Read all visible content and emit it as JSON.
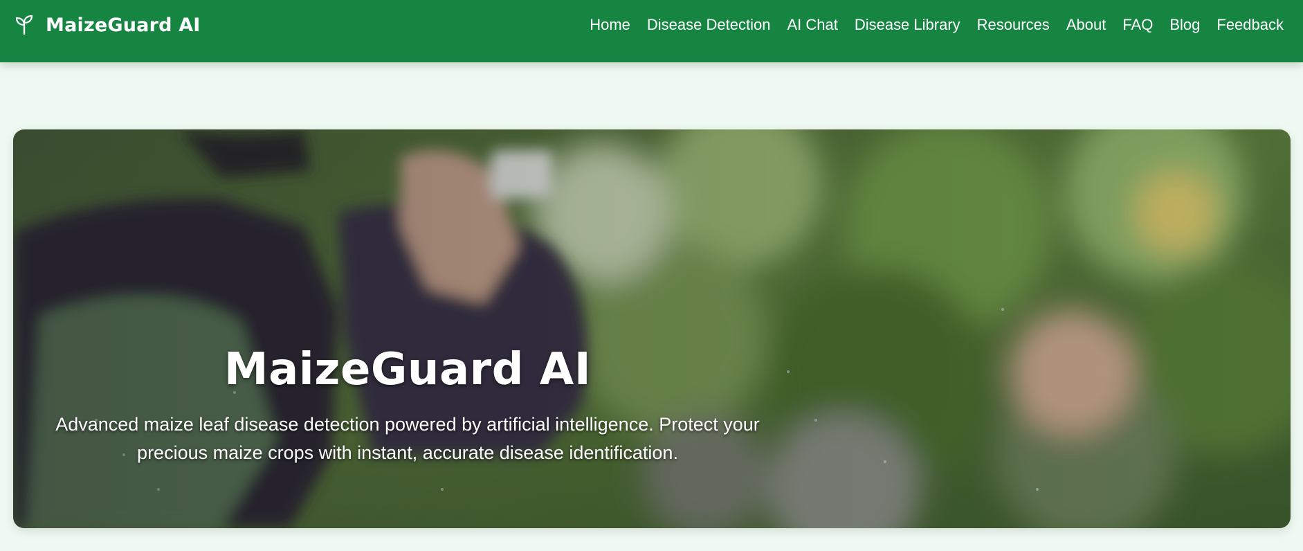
{
  "brand": {
    "name": "MaizeGuard AI",
    "icon": "seedling-icon"
  },
  "nav": {
    "items": [
      {
        "label": "Home"
      },
      {
        "label": "Disease Detection"
      },
      {
        "label": "AI Chat"
      },
      {
        "label": "Disease Library"
      },
      {
        "label": "Resources"
      },
      {
        "label": "About"
      },
      {
        "label": "FAQ"
      },
      {
        "label": "Blog"
      },
      {
        "label": "Feedback"
      }
    ]
  },
  "hero": {
    "title": "MaizeGuard AI",
    "subtitle": "Advanced maize leaf disease detection powered by artificial intelligence. Protect your precious maize crops with instant, accurate disease identification."
  },
  "colors": {
    "navbar": "#178542",
    "page_background": "#eefaf1",
    "text_on_dark": "#ffffff"
  }
}
